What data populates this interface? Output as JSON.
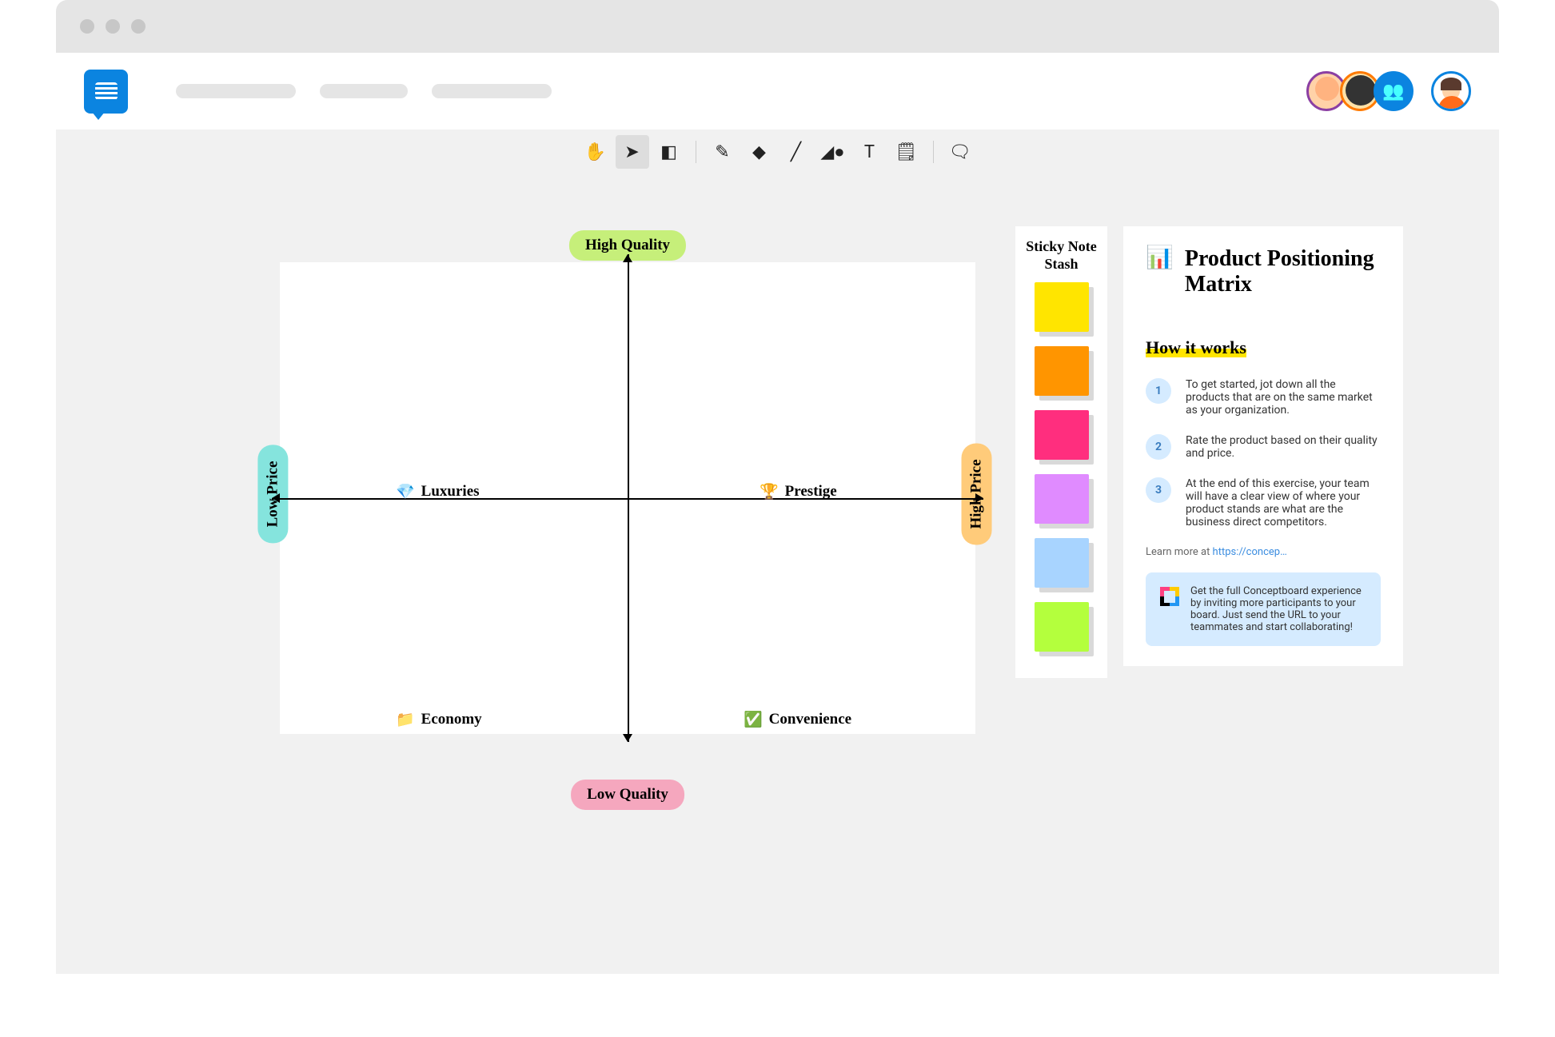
{
  "axis": {
    "top": "High Quality",
    "bottom": "Low Quality",
    "left": "Low Price",
    "right": "High Price"
  },
  "quadrants": {
    "tl_icon": "💎",
    "tl": "Luxuries",
    "tr_icon": "🏆",
    "tr": "Prestige",
    "bl_icon": "📁",
    "bl": "Economy",
    "br_icon": "✅",
    "br": "Convenience"
  },
  "sticky_title": "Sticky Note Stash",
  "info": {
    "title": "Product Positioning Matrix",
    "how": "How it works",
    "steps": [
      {
        "n": "1",
        "t": "To get started, jot down all the products that are on the same market as your organization."
      },
      {
        "n": "2",
        "t": "Rate the product based on their quality and price."
      },
      {
        "n": "3",
        "t": "At the end of this exercise, your team will have a clear view of where your product stands are what are the business direct competitors."
      }
    ],
    "learn": "Learn more at ",
    "learn_link": "https://concep…",
    "promo": "Get the full Conceptboard experience by inviting more participants to your board. Just send the URL to your teammates and start collaborating!"
  }
}
